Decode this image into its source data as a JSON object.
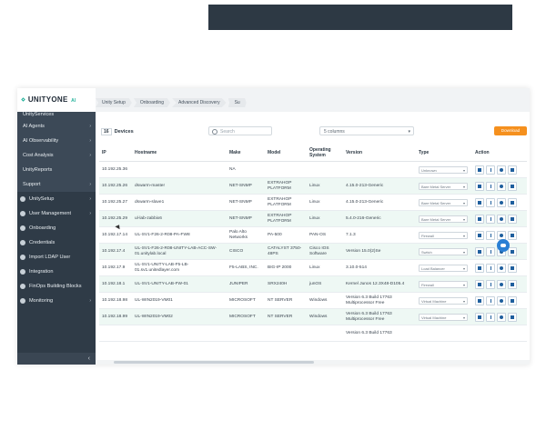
{
  "logo": {
    "mark": "⋄",
    "name": "UNITYONE",
    "ai": "AI"
  },
  "sidebar": {
    "items": [
      {
        "label": "UnityServices",
        "sub": true,
        "cut": true
      },
      {
        "label": "AI Agents",
        "sub": true,
        "chevron": true
      },
      {
        "label": "AI Observability",
        "sub": true,
        "chevron": true
      },
      {
        "label": "Cost Analysis",
        "sub": true,
        "chevron": true
      },
      {
        "label": "UnityReports",
        "sub": true
      },
      {
        "label": "Support",
        "sub": true,
        "chevron": true
      },
      {
        "label": "UnitySetup",
        "sub": false,
        "chevron": true
      },
      {
        "label": "User Management",
        "sub": false,
        "chevron": true
      },
      {
        "label": "Onboarding",
        "sub": false
      },
      {
        "label": "Credentials",
        "sub": false
      },
      {
        "label": "Import LDAP User",
        "sub": false
      },
      {
        "label": "Integration",
        "sub": false
      },
      {
        "label": "FinOps Building Blocks",
        "sub": false
      },
      {
        "label": "Monitoring",
        "sub": false,
        "chevron": true
      }
    ],
    "collapse_icon": "‹"
  },
  "breadcrumbs": [
    "Unity Setup",
    "Onboarding",
    "Advanced Discovery",
    "Su"
  ],
  "toolbar": {
    "count": "16",
    "count_label": "Devices",
    "search_placeholder": "Search",
    "columns_label": "5 columns",
    "download_label": "Download"
  },
  "table": {
    "headers": [
      "IP",
      "Hostname",
      "Make",
      "Model",
      "Operating System",
      "Version",
      "Type",
      "Action"
    ],
    "rows": [
      {
        "ip": "10.192.25.36",
        "host": "",
        "make": "NA",
        "model": "",
        "os": "",
        "version": "",
        "type": "Unknown"
      },
      {
        "ip": "10.192.25.26",
        "host": "dswarm-master",
        "make": "NET-SNMP",
        "model": "EXTRAHOP PLATFORM",
        "os": "Linux",
        "version": "4.15.0-213-Generic",
        "type": "Bare Metal Server"
      },
      {
        "ip": "10.192.25.27",
        "host": "dswarm-slave1",
        "make": "NET-SNMP",
        "model": "EXTRAHOP PLATFORM",
        "os": "Linux",
        "version": "4.15.0-213-Generic",
        "type": "Bare Metal Server"
      },
      {
        "ip": "10.192.25.29",
        "host": "ul-lab-zabbix6",
        "make": "NET-SNMP",
        "model": "EXTRAHOP PLATFORM",
        "os": "Linux",
        "version": "5.4.0-216-Generic",
        "type": "Bare Metal Server"
      },
      {
        "ip": "10.192.17.14",
        "host": "UL-SV1-F26-2-R08-PA-FW8",
        "make": "Palo Alto Networks",
        "model": "PA-500",
        "os": "PAN-OS",
        "version": "7.1.3",
        "type": "Firewall"
      },
      {
        "ip": "10.192.17.4",
        "host": "UL-SV1-F26-2-R08-UNITY-LAB-ACC-SW-01.unitylab.local",
        "make": "CISCO",
        "model": "CATALYST 3750-48PS",
        "os": "Cisco IOS Software",
        "version": "Version 15.0(2)Se",
        "type": "Switch"
      },
      {
        "ip": "10.192.17.9",
        "host": "UL-SV1-UNITY-LAB-F5-LB-01.sv1.unitedlayer.com",
        "make": "F5-LABS, INC.",
        "model": "BIG-IP 2000",
        "os": "Linux",
        "version": "3.10.0-514",
        "type": "Load Balancer"
      },
      {
        "ip": "10.192.18.1",
        "host": "UL-SV1-UNITY-LAB-FW-01",
        "make": "JUNIPER",
        "model": "SRX240H",
        "os": "junOS",
        "version": "Kernel Junos 12.3X48-D105.4",
        "type": "Firewall"
      },
      {
        "ip": "10.192.18.98",
        "host": "UL-WIN2019-VM01",
        "make": "MICROSOFT",
        "model": "NT SERVER",
        "os": "Windows",
        "version": "Version 6.3 Build 17763 Multiprocessor Free",
        "type": "Virtual Machine"
      },
      {
        "ip": "10.192.18.99",
        "host": "UL-WIN2019-VM02",
        "make": "MICROSOFT",
        "model": "NT SERVER",
        "os": "Windows",
        "version": "Version 6.3 Build 17763 Multiprocessor Free",
        "type": "Virtual Machine"
      },
      {
        "ip": "",
        "host": "",
        "make": "",
        "model": "",
        "os": "",
        "version": "Version 6.3 Build 17763",
        "type": ""
      }
    ]
  }
}
